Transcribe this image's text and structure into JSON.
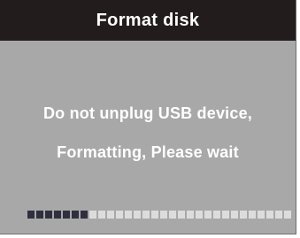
{
  "dialog": {
    "title": "Format disk",
    "line1": "Do not unplug USB device,",
    "line2": "Formatting, Please wait"
  },
  "progress": {
    "filled_segments": 7,
    "total_segments": 30,
    "fraction": 0.233
  },
  "colors": {
    "title_bar": "#231c1c",
    "screen_background": "#a8a8a8",
    "text": "#ffffff",
    "progress_filled": "#2f2f3f",
    "progress_empty": "#dcdcdc"
  }
}
